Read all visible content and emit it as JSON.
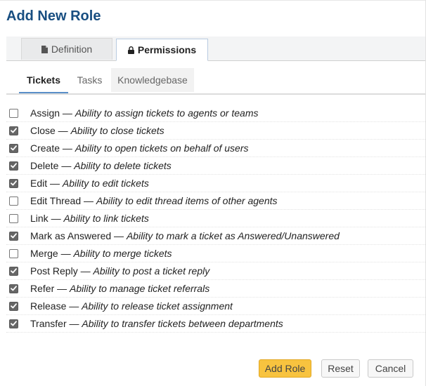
{
  "page_title": "Add New Role",
  "tabs": [
    {
      "label": "Definition",
      "icon": "document-icon",
      "active": false
    },
    {
      "label": "Permissions",
      "icon": "lock-icon",
      "active": true
    }
  ],
  "subtabs": [
    {
      "label": "Tickets",
      "active": true
    },
    {
      "label": "Tasks",
      "active": false
    },
    {
      "label": "Knowledgebase",
      "active": false
    }
  ],
  "permissions": [
    {
      "name": "Assign",
      "sep": " — ",
      "desc": "Ability to assign tickets to agents or teams",
      "checked": false
    },
    {
      "name": "Close",
      "sep": " — ",
      "desc": "Ability to close tickets",
      "checked": true
    },
    {
      "name": "Create",
      "sep": " — ",
      "desc": "Ability to open tickets on behalf of users",
      "checked": true
    },
    {
      "name": "Delete",
      "sep": " — ",
      "desc": "Ability to delete tickets",
      "checked": true
    },
    {
      "name": "Edit",
      "sep": " — ",
      "desc": "Ability to edit tickets",
      "checked": true
    },
    {
      "name": "Edit Thread",
      "sep": " — ",
      "desc": "Ability to edit thread items of other agents",
      "checked": false
    },
    {
      "name": "Link",
      "sep": " — ",
      "desc": "Ability to link tickets",
      "checked": false
    },
    {
      "name": "Mark as Answered",
      "sep": " — ",
      "desc": "Ability to mark a ticket as Answered/Unanswered",
      "checked": true
    },
    {
      "name": "Merge",
      "sep": " — ",
      "desc": "Ability to merge tickets",
      "checked": false
    },
    {
      "name": "Post Reply",
      "sep": " — ",
      "desc": "Ability to post a ticket reply",
      "checked": true
    },
    {
      "name": "Refer",
      "sep": " — ",
      "desc": "Ability to manage ticket referrals",
      "checked": true
    },
    {
      "name": "Release",
      "sep": " — ",
      "desc": "Ability to release ticket assignment",
      "checked": true
    },
    {
      "name": "Transfer",
      "sep": " — ",
      "desc": "Ability to transfer tickets between departments",
      "checked": true
    }
  ],
  "buttons": {
    "add_role": "Add Role",
    "reset": "Reset",
    "cancel": "Cancel"
  },
  "colors": {
    "title": "#184e81",
    "primary_button": "#f8c33f",
    "active_subtab_underline": "#5a8fc8"
  }
}
